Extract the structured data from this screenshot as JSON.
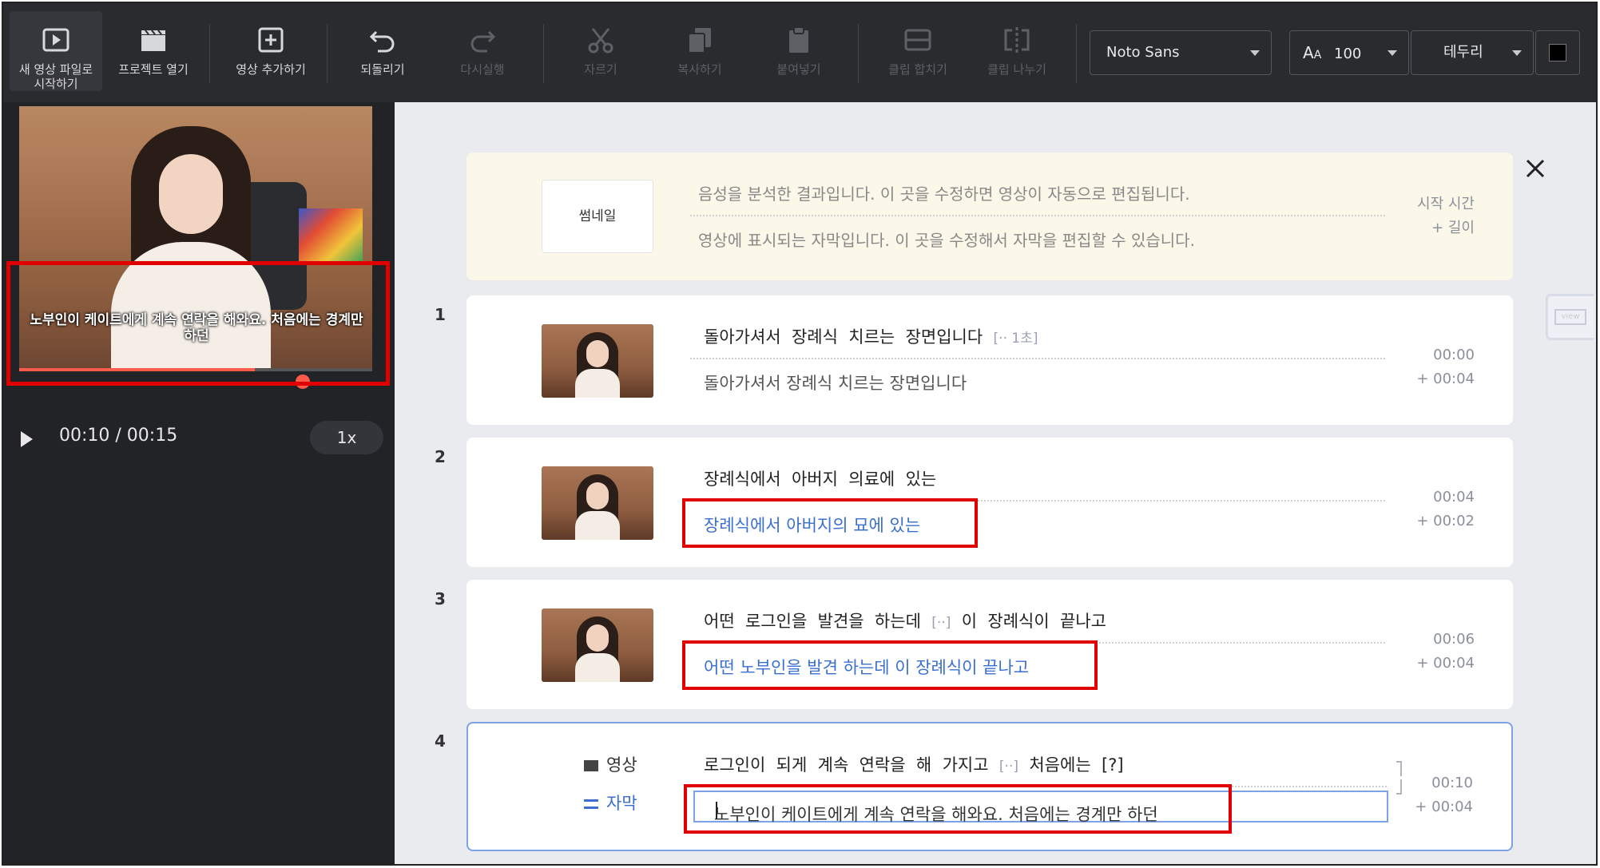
{
  "toolbar": {
    "new_video": "새 영상 파일로 시작하기",
    "open_project": "프로젝트 열기",
    "add_video": "영상 추가하기",
    "undo": "되돌리기",
    "redo": "다시실행",
    "cut": "자르기",
    "copy": "복사하기",
    "paste": "붙여넣기",
    "merge_clip": "클립 합치기",
    "split_clip": "클립 나누기",
    "font": "Noto Sans",
    "font_size": "100",
    "border": "테두리",
    "color_swatch": "#000000"
  },
  "player": {
    "subtitle": "노부인이 케이트에게 계속 연락을 해와요. 처음에는 경계만 하던",
    "time": "00:10 / 00:15",
    "speed": "1x",
    "progress": 0.667
  },
  "header": {
    "thumbnail_label": "썸네일",
    "speech_desc": "음성을 분석한 결과입니다. 이 곳을 수정하면 영상이 자동으로 편집됩니다.",
    "subtitle_desc": "영상에 표시되는 자막입니다. 이 곳을 수정해서 자막을 편집할 수 있습니다.",
    "start_time": "시작 시간",
    "length": "+ 길이"
  },
  "side_tab": "view",
  "rows": [
    {
      "num": "1",
      "speech": "돌아가셔서  장례식  치르는  장면입니다",
      "gap": "[·· 1초]",
      "subtitle": "돌아가셔서 장례식 치르는 장면입니다",
      "start": "00:00",
      "length": "+ 00:04"
    },
    {
      "num": "2",
      "speech": "장례식에서  아버지  의료에  있는",
      "subtitle": "장례식에서 아버지의 묘에 있는",
      "start": "00:04",
      "length": "+ 00:02"
    },
    {
      "num": "3",
      "speech_a": "어떤  로그인을  발견을  하는데",
      "gap": "[··]",
      "speech_b": "이  장례식이  끝나고",
      "subtitle": "어떤 노부인을 발견 하는데 이 장례식이 끝나고",
      "start": "00:06",
      "length": "+ 00:04"
    },
    {
      "num": "4",
      "video_label": "영상",
      "subtitle_label": "자막",
      "speech_a": "로그인이  되게  계속  연락을  해  가지고",
      "gap": "[··]",
      "speech_b": "처음에는",
      "unknown": "[?]",
      "subtitle": "노부인이 케이트에게 계속 연락을 해와요. 처음에는 경계만 하던",
      "start": "00:10",
      "length": "+ 00:04"
    }
  ]
}
